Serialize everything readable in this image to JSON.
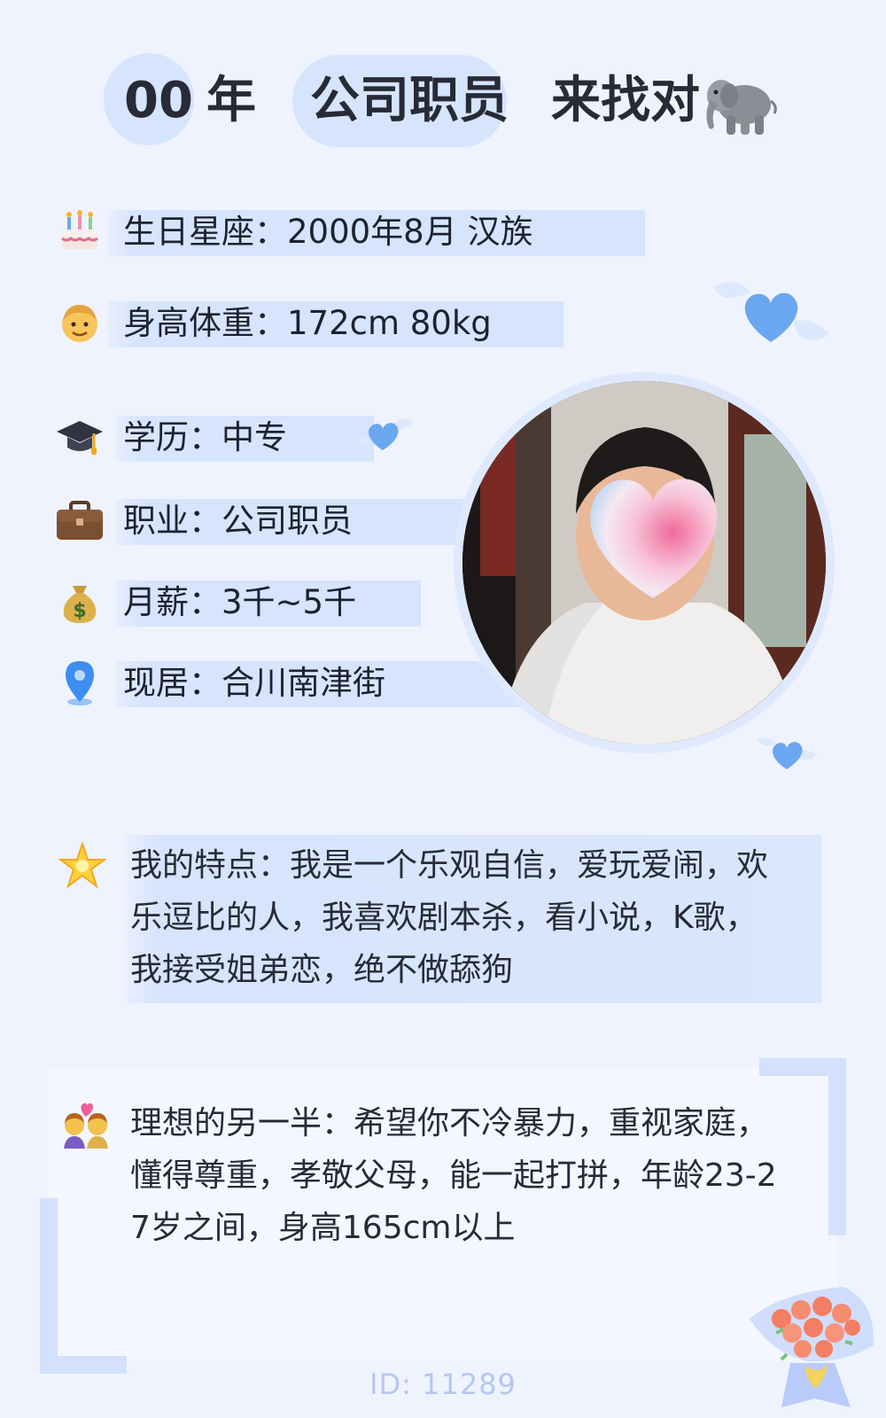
{
  "header": {
    "year": "00",
    "year_suffix": "年",
    "occupation": "公司职员",
    "seeking": "来找对",
    "seeking_icon": "elephant-icon"
  },
  "info": [
    {
      "icon": "birthday-cake-icon",
      "text": "生日星座：2000年8月 汉族"
    },
    {
      "icon": "man-face-icon",
      "text": "身高体重：172cm 80kg"
    },
    {
      "icon": "graduation-cap-icon",
      "text": "学历：中专"
    },
    {
      "icon": "briefcase-icon",
      "text": "职业：公司职员"
    },
    {
      "icon": "money-bag-icon",
      "text": "月薪：3千~5千"
    },
    {
      "icon": "location-pin-icon",
      "text": "现居：合川南津街"
    }
  ],
  "features": {
    "icon": "glowing-star-icon",
    "lines": [
      "我的特点：我是一个乐观自信，爱玩爱闹，欢",
      "乐逗比的人，我喜欢剧本杀，看小说，K歌，",
      "我接受姐弟恋，绝不做舔狗"
    ]
  },
  "ideal": {
    "icon": "couple-with-heart-icon",
    "lines": [
      "理想的另一半：希望你不冷暴力，重视家庭，",
      "懂得尊重，孝敬父母，能一起打拼，年龄23-2",
      "7岁之间，身高165cm以上"
    ]
  },
  "footer": {
    "id": "ID: 11289"
  },
  "colors": {
    "background": "#eef3fe",
    "highlight": "#d6e4fd",
    "text": "#1f2533",
    "heart": "#5b9cf2",
    "id": "#b5c7ef"
  }
}
